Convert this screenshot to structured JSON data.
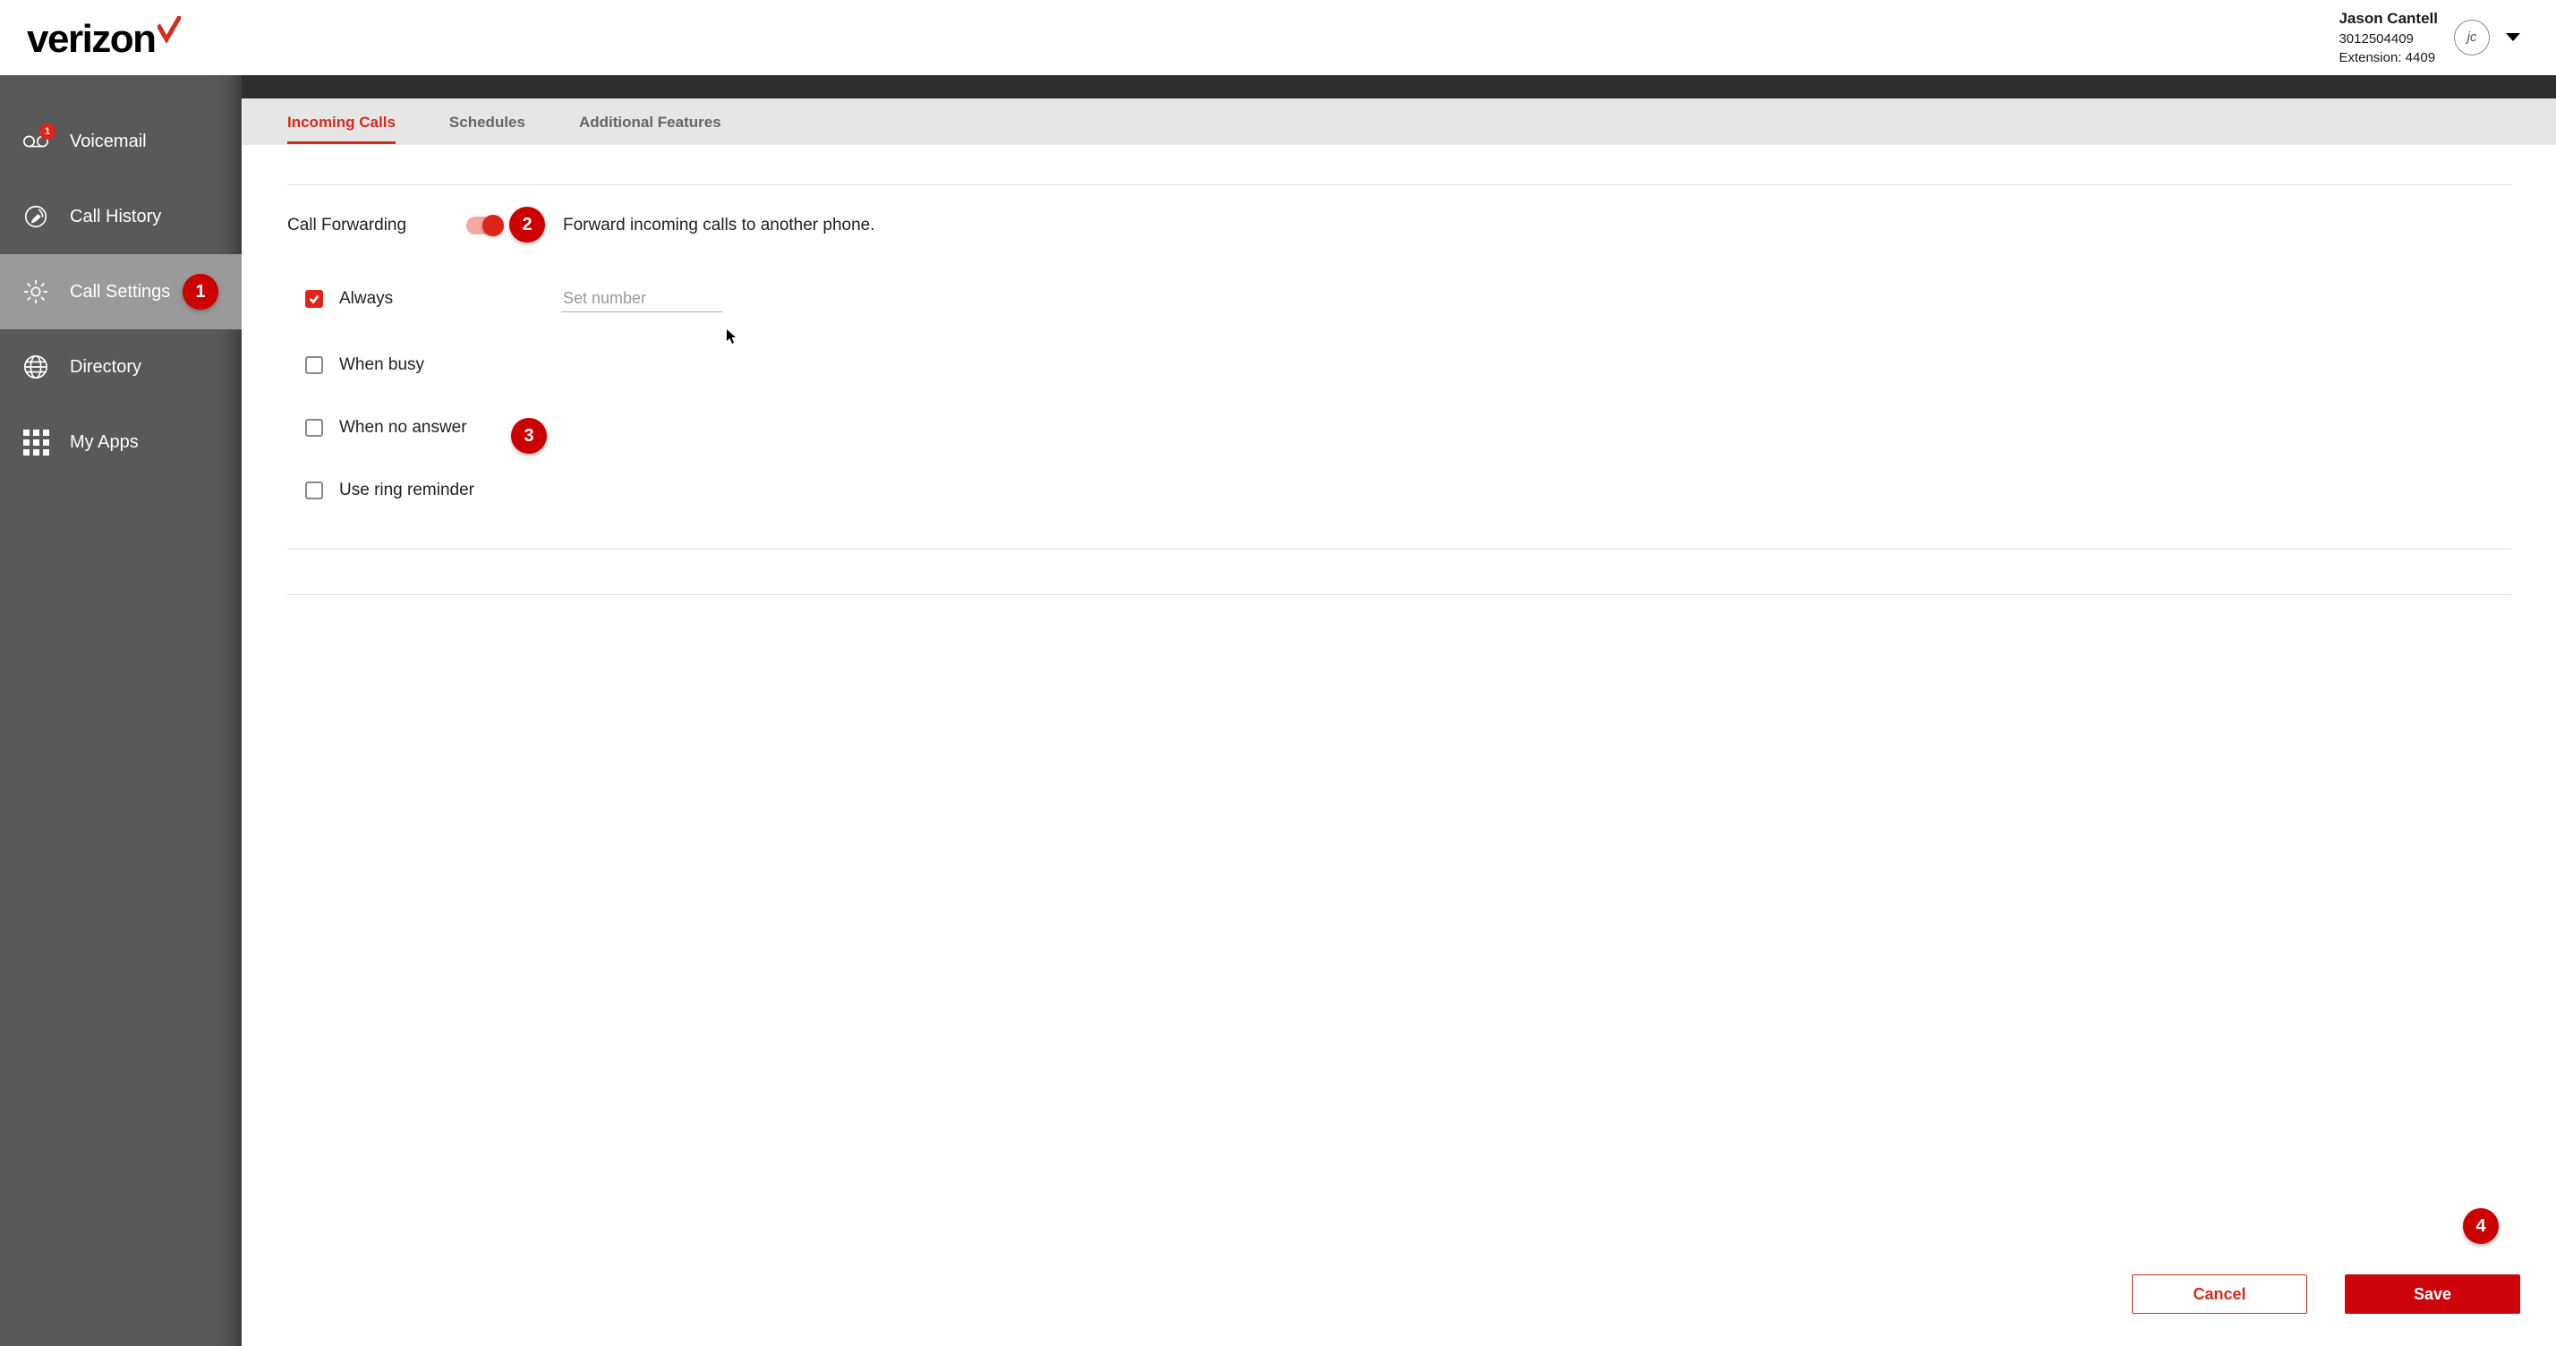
{
  "brand": {
    "name": "verizon"
  },
  "user": {
    "name": "Jason Cantell",
    "account": "3012504409",
    "extension_label": "Extension: 4409",
    "initials": "jc"
  },
  "sidebar": {
    "items": [
      {
        "label": "Voicemail",
        "badge": "1"
      },
      {
        "label": "Call History"
      },
      {
        "label": "Call Settings"
      },
      {
        "label": "Directory"
      },
      {
        "label": "My Apps"
      }
    ],
    "selected_index": 2
  },
  "tabs": [
    {
      "label": "Incoming Calls",
      "active": true
    },
    {
      "label": "Schedules",
      "active": false
    },
    {
      "label": "Additional Features",
      "active": false
    }
  ],
  "call_forwarding": {
    "title": "Call Forwarding",
    "description": "Forward incoming calls to another phone.",
    "enabled": true,
    "options": {
      "always": {
        "label": "Always",
        "checked": true,
        "placeholder": "Set number",
        "value": ""
      },
      "when_busy": {
        "label": "When busy",
        "checked": false
      },
      "when_no_answer": {
        "label": "When no answer",
        "checked": false
      },
      "ring_reminder": {
        "label": "Use ring reminder",
        "checked": false
      }
    }
  },
  "footer": {
    "cancel": "Cancel",
    "save": "Save"
  },
  "step_badges": {
    "s1": "1",
    "s2": "2",
    "s3": "3",
    "s4": "4"
  }
}
